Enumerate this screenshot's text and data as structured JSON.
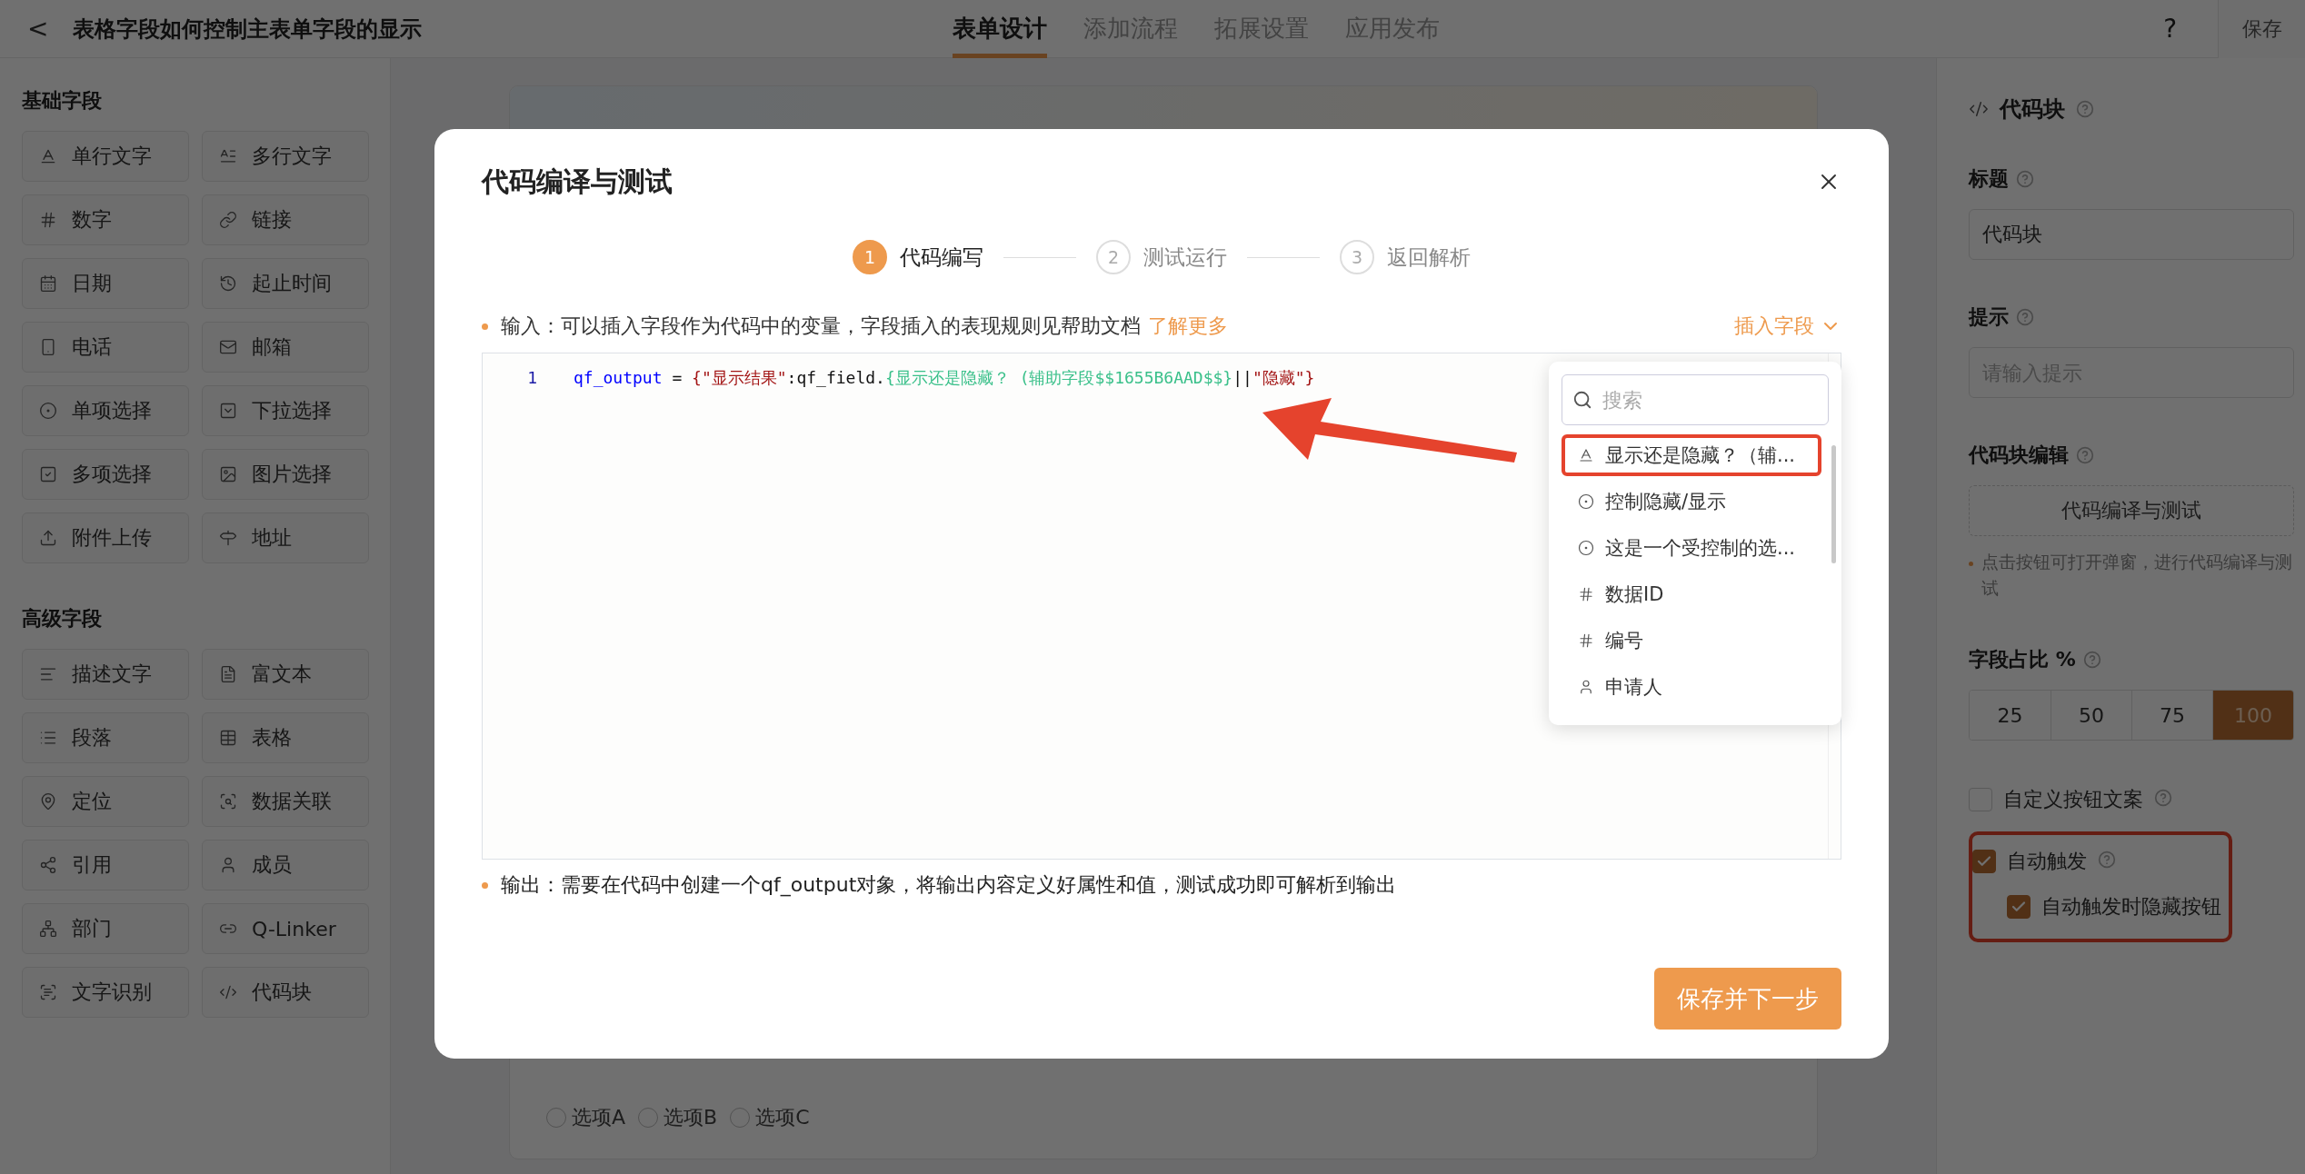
{
  "topbar": {
    "back": "<",
    "title": "表格字段如何控制主表单字段的显示",
    "tabs": [
      {
        "label": "表单设计",
        "selected": true
      },
      {
        "label": "添加流程",
        "selected": false
      },
      {
        "label": "拓展设置",
        "selected": false
      },
      {
        "label": "应用发布",
        "selected": false
      }
    ],
    "help": "?",
    "save": "保存"
  },
  "sidebar": {
    "sections": [
      {
        "title": "基础字段",
        "items": [
          "单行文字",
          "多行文字",
          "数字",
          "链接",
          "日期",
          "起止时间",
          "电话",
          "邮箱",
          "单项选择",
          "下拉选择",
          "多项选择",
          "图片选择",
          "附件上传",
          "地址"
        ]
      },
      {
        "title": "高级字段",
        "items": [
          "描述文字",
          "富文本",
          "段落",
          "表格",
          "定位",
          "数据关联",
          "引用",
          "成员",
          "部门",
          "Q-Linker",
          "文字识别",
          "代码块"
        ]
      }
    ]
  },
  "canvas": {
    "radio_options": [
      {
        "label": "选项A",
        "selected": false
      },
      {
        "label": "选项B",
        "selected": false
      },
      {
        "label": "选项C",
        "selected": false
      }
    ]
  },
  "properties": {
    "title": "代码块",
    "fields": [
      {
        "label": "标题",
        "value": "代码块"
      },
      {
        "label": "提示",
        "placeholder": "请输入提示"
      }
    ],
    "editor_label": "代码块编辑",
    "editor_button": "代码编译与测试",
    "editor_note": "点击按钮可打开弹窗，进行代码编译与测试",
    "width_label": "字段占比 %",
    "width_options": [
      {
        "label": "25",
        "selected": false
      },
      {
        "label": "50",
        "selected": false
      },
      {
        "label": "75",
        "selected": false
      },
      {
        "label": "100",
        "selected": true
      }
    ],
    "custom_button": {
      "label": "自定义按钮文案",
      "checked": false
    },
    "auto_trigger": {
      "label": "自动触发",
      "checked": true,
      "annotated": true,
      "children": [
        {
          "label": "自动触发时隐藏按钮",
          "checked": true
        }
      ]
    }
  },
  "dialog": {
    "title": "代码编译与测试",
    "steps": [
      {
        "number": "1",
        "label": "代码编写",
        "selected": true
      },
      {
        "number": "2",
        "label": "测试运行",
        "selected": false
      },
      {
        "number": "3",
        "label": "返回解析",
        "selected": false
      }
    ],
    "input_hint": "输入：可以插入字段作为代码中的变量，字段插入的表现规则见帮助文档",
    "learn_more": "了解更多",
    "insert_field": "插入字段",
    "code_lines": [
      {
        "number": "1",
        "tokens": [
          {
            "kind": "variable",
            "text": "qf_output"
          },
          {
            "kind": "plain",
            "text": " = "
          },
          {
            "kind": "string",
            "text": "{\"显示结果\""
          },
          {
            "kind": "plain",
            "text": ":qf_field."
          },
          {
            "kind": "field",
            "text": "{显示还是隐藏？ (辅助字段$$1655B6AAD$$}"
          },
          {
            "kind": "plain",
            "text": "||"
          },
          {
            "kind": "string",
            "text": "\"隐藏\"}"
          }
        ]
      }
    ],
    "output_hint": "输出：需要在代码中创建一个qf_output对象，将输出内容定义好属性和值，测试成功即可解析到输出",
    "primary_button": "保存并下一步",
    "field_menu": {
      "search_placeholder": "搜索",
      "items": [
        {
          "kind": "text",
          "label": "显示还是隐藏？（辅...",
          "annotated": true
        },
        {
          "kind": "radio",
          "label": "控制隐藏/显示",
          "annotated": false
        },
        {
          "kind": "radio",
          "label": "这是一个受控制的选...",
          "annotated": false
        },
        {
          "kind": "number",
          "label": "数据ID",
          "annotated": false
        },
        {
          "kind": "number",
          "label": "编号",
          "annotated": false
        },
        {
          "kind": "user",
          "label": "申请人",
          "annotated": false
        }
      ]
    }
  }
}
